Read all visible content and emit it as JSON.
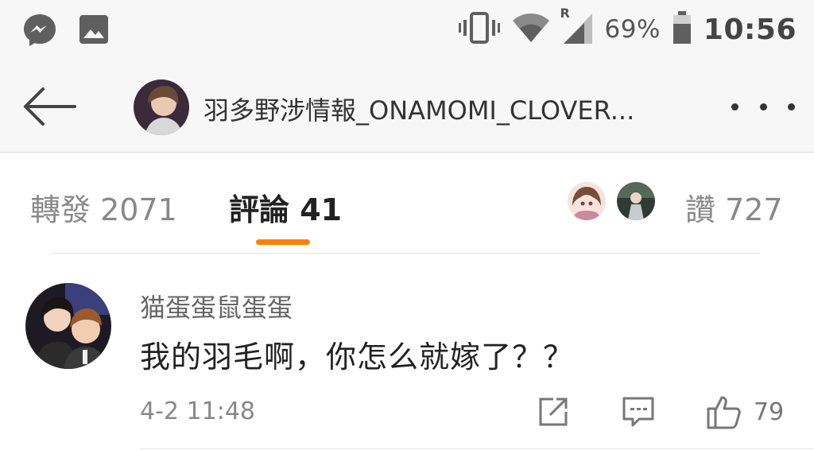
{
  "status_bar": {
    "left_icons": [
      "messenger-icon",
      "image-icon"
    ],
    "right_icons": [
      "vibrate-icon",
      "wifi-icon",
      "signal-icon",
      "battery-icon"
    ],
    "roaming_label": "R",
    "battery_percent": "69%",
    "time": "10:56"
  },
  "header": {
    "title": "羽多野涉情報_ONAMOMI_CLOVER...",
    "back_icon": "arrow-left-icon",
    "more_icon": "more-dots-icon"
  },
  "tabs": {
    "reposts_label": "轉發 2071",
    "comments_label": "評論 41",
    "likes_label": "讚 727",
    "active": "comments",
    "accent_color": "#ff8200"
  },
  "comment": {
    "username": "猫蛋蛋鼠蛋蛋",
    "text": "我的羽毛啊，你怎么就嫁了？？",
    "timestamp": "4-2 11:48",
    "like_count": "79",
    "icons": [
      "share-icon",
      "reply-icon",
      "thumbs-up-icon"
    ]
  }
}
